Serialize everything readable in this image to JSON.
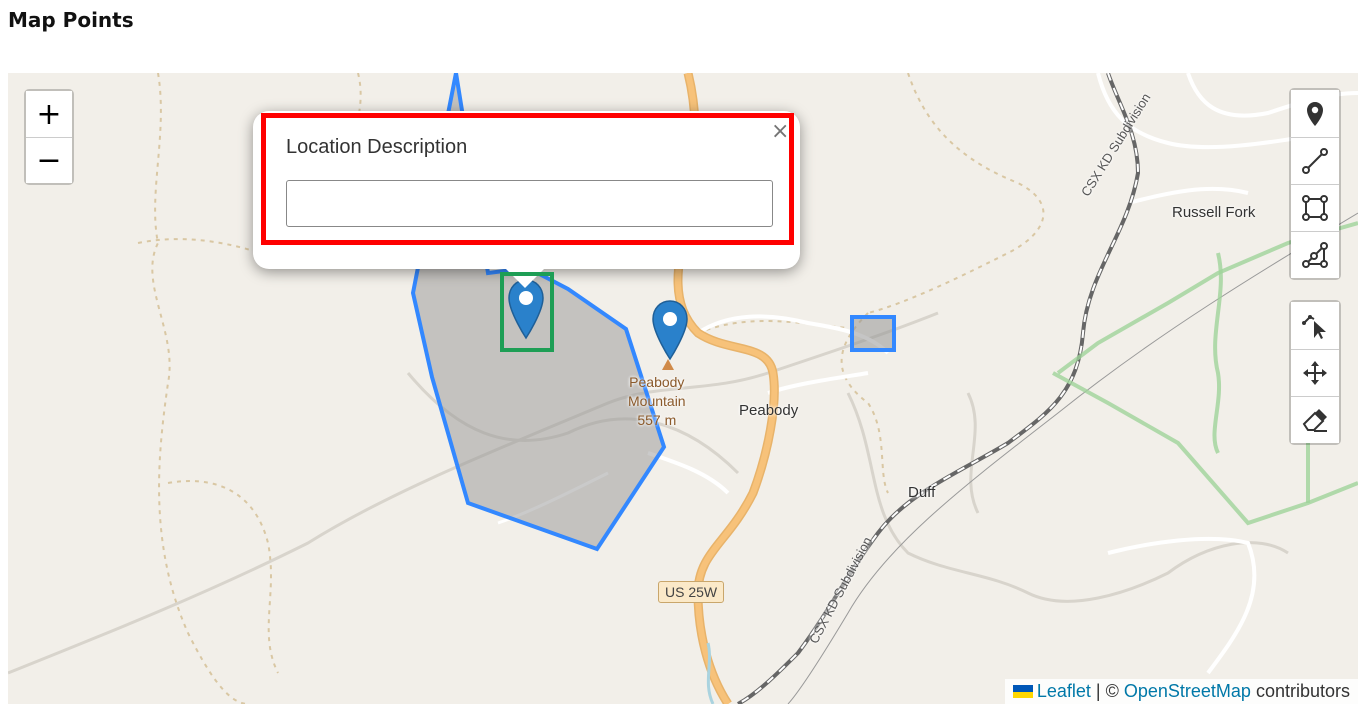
{
  "page": {
    "title": "Map Points"
  },
  "map": {
    "labels": {
      "russell_fork": "Russell Fork",
      "peabody": "Peabody",
      "duff": "Duff",
      "peak_name_1": "Peabody",
      "peak_name_2": "Mountain",
      "peak_elevation": "557 m",
      "rail_1": "CSX KD Subdivision",
      "rail_2": "CSX KD Subdivision",
      "highway_shield": "US 25W"
    },
    "zoom": {
      "in_label": "+",
      "out_label": "−"
    },
    "draw_tools": [
      {
        "name": "marker-tool",
        "icon": "map-pin-icon"
      },
      {
        "name": "polyline-tool",
        "icon": "polyline-icon"
      },
      {
        "name": "rectangle-tool",
        "icon": "rectangle-icon"
      },
      {
        "name": "polygon-tool",
        "icon": "polygon-icon"
      }
    ],
    "edit_tools": [
      {
        "name": "edit-vertices-tool",
        "icon": "edit-cursor-icon"
      },
      {
        "name": "drag-tool",
        "icon": "move-arrows-icon"
      },
      {
        "name": "remove-tool",
        "icon": "eraser-icon"
      }
    ],
    "attribution": {
      "leaflet": "Leaflet",
      "separator": " | © ",
      "osm": "OpenStreetMap",
      "suffix": " contributors"
    },
    "colors": {
      "background": "#f2efe9",
      "shape_stroke": "#3388ff",
      "shape_fill": "#a9a9a9",
      "marker": "#2a81cb",
      "highlight_red": "#ff0000",
      "highlight_green": "#1e9e55",
      "road": "#f7c27a",
      "rail": "#666666",
      "boundary": "#9fd39a"
    }
  },
  "popup": {
    "label": "Location Description",
    "input_value": "",
    "input_placeholder": "",
    "close_label": "×"
  }
}
